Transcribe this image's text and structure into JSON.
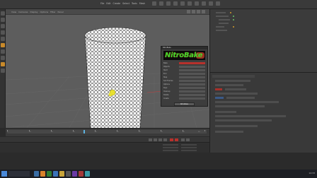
{
  "app": {
    "menu": [
      "File",
      "Edit",
      "Create",
      "Select",
      "Tools",
      "Mesh",
      "Snap",
      "Animate",
      "Simulate",
      "Render",
      "Window",
      "Help"
    ],
    "viewport_menu": [
      "View",
      "Cameras",
      "Display",
      "Options",
      "Filter",
      "Panel"
    ]
  },
  "dialog": {
    "title": "NitroBake",
    "logo_text": "NitroBake",
    "rows": [
      {
        "label": "Bake"
      },
      {
        "label": "Objects"
      },
      {
        "label": "Start"
      },
      {
        "label": "End"
      },
      {
        "label": "Step"
      },
      {
        "label": "Sub Frames"
      },
      {
        "label": "Options"
      },
      {
        "label": "Keys"
      },
      {
        "label": "Cleanup"
      },
      {
        "label": "Delete"
      },
      {
        "label": "Create"
      }
    ],
    "button": "NitroBake"
  },
  "timeline": {
    "ticks": [
      "0",
      "10",
      "20",
      "30",
      "40",
      "50",
      "60",
      "70",
      "80",
      "90"
    ]
  },
  "taskbar": {
    "clock": "14:33"
  },
  "colors": {
    "viewport_bg": "#5d5d5d",
    "accent_green": "#3cdc2a",
    "accent_red": "#b7312c",
    "highlight_yellow": "#e8e030"
  }
}
